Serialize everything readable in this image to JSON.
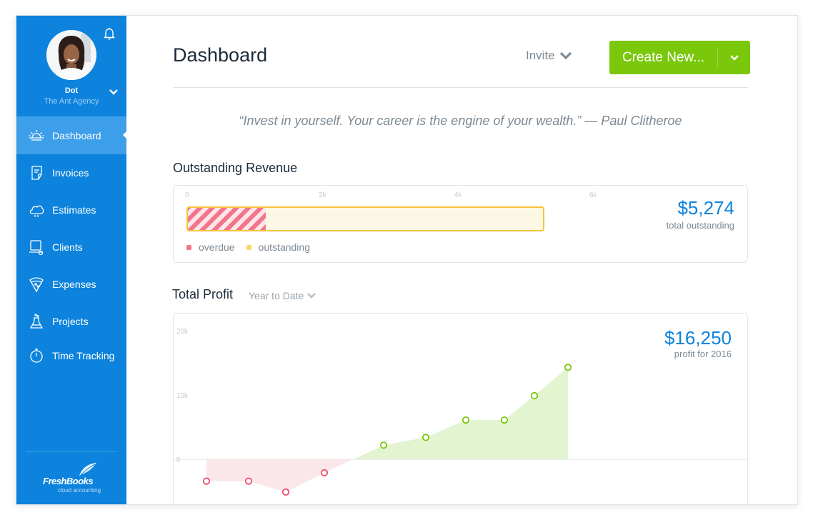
{
  "user": {
    "name": "Dot",
    "company": "The Ant Agency"
  },
  "icons": {
    "bell": "bell-icon",
    "user_menu": "chevron-down-icon"
  },
  "nav": [
    {
      "label": "Dashboard",
      "icon": "sunrise-icon",
      "active": true
    },
    {
      "label": "Invoices",
      "icon": "invoice-icon",
      "active": false
    },
    {
      "label": "Estimates",
      "icon": "cloud-icon",
      "active": false
    },
    {
      "label": "Clients",
      "icon": "client-icon",
      "active": false
    },
    {
      "label": "Expenses",
      "icon": "pizza-icon",
      "active": false
    },
    {
      "label": "Projects",
      "icon": "flask-icon",
      "active": false
    },
    {
      "label": "Time Tracking",
      "icon": "stopwatch-icon",
      "active": false
    }
  ],
  "logo": {
    "main": "FreshBooks",
    "sub": "cloud accounting"
  },
  "header": {
    "title": "Dashboard",
    "invite": "Invite",
    "create_new": "Create New..."
  },
  "quote": "“Invest in yourself. Your career is the engine of your wealth.” — Paul Clitheroe",
  "colors": {
    "brand_blue": "#0d83dd",
    "green": "#7ac70c",
    "overdue": "#f2768a",
    "outstanding": "#f7c33b"
  },
  "outstanding": {
    "title": "Outstanding Revenue",
    "ticks": [
      "0",
      "2k",
      "4k",
      "6k"
    ],
    "overdue_label": "overdue",
    "outstanding_label": "outstanding",
    "amount": "$5,274",
    "caption": "total outstanding"
  },
  "profit": {
    "title": "Total Profit",
    "period": "Year to Date",
    "amount": "$16,250",
    "caption": "profit for 2016"
  },
  "chart_data": [
    {
      "type": "bar",
      "title": "Outstanding Revenue",
      "xlim": [
        0,
        6000
      ],
      "ticks": [
        "0",
        "2k",
        "4k",
        "6k"
      ],
      "series": [
        {
          "name": "overdue",
          "values": [
            1150
          ]
        },
        {
          "name": "outstanding",
          "values": [
            5274
          ]
        }
      ]
    },
    {
      "type": "area",
      "title": "Total Profit",
      "ylim": [
        -5000,
        20000
      ],
      "yticks": [
        "20k",
        "10k",
        "0"
      ],
      "x": [
        1,
        2,
        3,
        4,
        5,
        6,
        7,
        8,
        9,
        10
      ],
      "values": [
        -3400,
        -3400,
        -5100,
        -2100,
        2200,
        3400,
        6100,
        6100,
        9900,
        14300
      ]
    }
  ]
}
